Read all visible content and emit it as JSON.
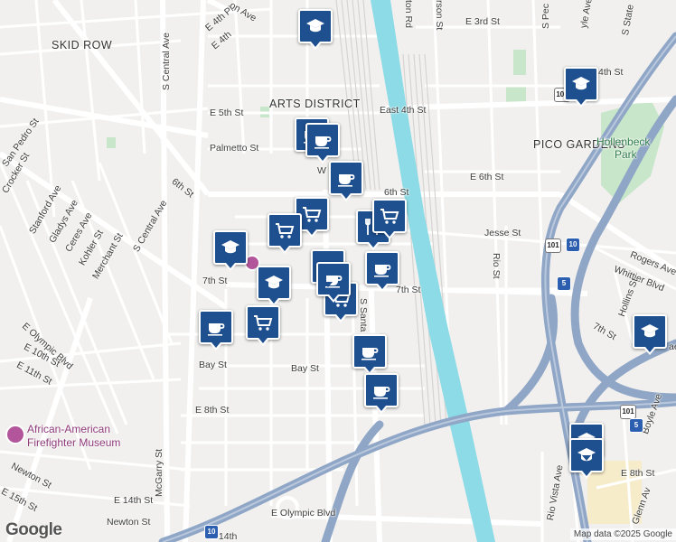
{
  "map": {
    "neighborhoods": [
      "SKID ROW",
      "ARTS DISTRICT",
      "PICO GARDENS"
    ],
    "parks": [
      "Hollenbeck",
      "Park"
    ],
    "poi": [
      "African-American",
      "Firefighter Museum"
    ],
    "streets": {
      "e_3rd": "E 3rd St",
      "e_4th_pl": "E 4th Pl",
      "e_4th": "E 4th",
      "e_5th": "E 5th St",
      "east_4th": "East 4th St",
      "palmetto": "Palmetto St",
      "w": "W",
      "sixth": "6th St",
      "e_6th": "E 6th St",
      "sixth_left": "6th St",
      "jesse": "Jesse St",
      "seventh": "7th St",
      "e_7th_frag": "7th St",
      "bay1": "Bay St",
      "bay2": "Bay St",
      "e_8th": "E 8th St",
      "e_8th_right": "E 8th St",
      "e_olympic": "E Olympic Blvd",
      "e_olympic_left": "E Olympic Blvd",
      "e_14th": "E 14th St",
      "newton": "Newton St",
      "newton2": "Newton St",
      "e_15th": "E 15th St",
      "e_14th_b": "E 14th",
      "mcgarry": "McGarry St",
      "s_central": "S Central Ave",
      "s_central2": "S Central Ave",
      "san_pedro": "San Pedro St",
      "crocker": "Crocker St",
      "stanford": "Stanford Ave",
      "gladys": "Gladys Ave",
      "ceres": "Ceres Ave",
      "kohler": "Kohler St",
      "merchant": "Merchant St",
      "e_10th": "E 10th St",
      "e_11th": "E 11th St",
      "s_santa": "S Santa Fe Ave",
      "rio": "Rio St",
      "rogers": "Rogers Ave",
      "whittier": "Whittier Blvd",
      "hollins": "Hollins St",
      "seventh_r": "7th St",
      "boyle": "Boyle Ave",
      "rio_vista": "Rio Vista Ave",
      "glenn": "Glenn Av",
      "ton_rd": "ton Rd",
      "rson_st": "rson St",
      "s_pec": "S Pec",
      "yle_ave": "yle Ave",
      "s_state": "S State",
      "fourth_r": "4th St",
      "on_ave": "on Ave",
      "ae": "ae"
    },
    "shields": [
      "101",
      "10",
      "5",
      "101",
      "5",
      "10",
      "101"
    ],
    "attribution": "Map data ©2025 Google",
    "logo": "Google",
    "colors": {
      "water": "#8ddbe6",
      "freeway": "#8fa6c6",
      "marker": "#1e4f8f",
      "park": "#c8e6c9"
    }
  },
  "markers": [
    {
      "type": "education",
      "name": "school-marker"
    },
    {
      "type": "education",
      "name": "school-marker"
    },
    {
      "type": "cafe",
      "name": "cafe-marker"
    },
    {
      "type": "cafe",
      "name": "cafe-marker"
    },
    {
      "type": "shopping",
      "name": "shopping-marker"
    },
    {
      "type": "restaurant",
      "name": "restaurant-marker"
    },
    {
      "type": "shopping",
      "name": "shopping-marker"
    },
    {
      "type": "cafe",
      "name": "cafe-marker"
    },
    {
      "type": "education",
      "name": "school-marker"
    },
    {
      "type": "cafe",
      "name": "cafe-marker"
    },
    {
      "type": "cafe",
      "name": "cafe-marker"
    },
    {
      "type": "education",
      "name": "school-marker"
    },
    {
      "type": "shopping",
      "name": "shopping-marker"
    },
    {
      "type": "shopping",
      "name": "shopping-marker"
    },
    {
      "type": "cafe",
      "name": "cafe-marker"
    },
    {
      "type": "shopping",
      "name": "shopping-marker"
    },
    {
      "type": "cafe",
      "name": "cafe-marker"
    },
    {
      "type": "cafe",
      "name": "cafe-marker"
    },
    {
      "type": "cafe",
      "name": "cafe-marker"
    },
    {
      "type": "education",
      "name": "school-marker"
    },
    {
      "type": "education",
      "name": "school-marker"
    },
    {
      "type": "education",
      "name": "school-marker"
    }
  ]
}
